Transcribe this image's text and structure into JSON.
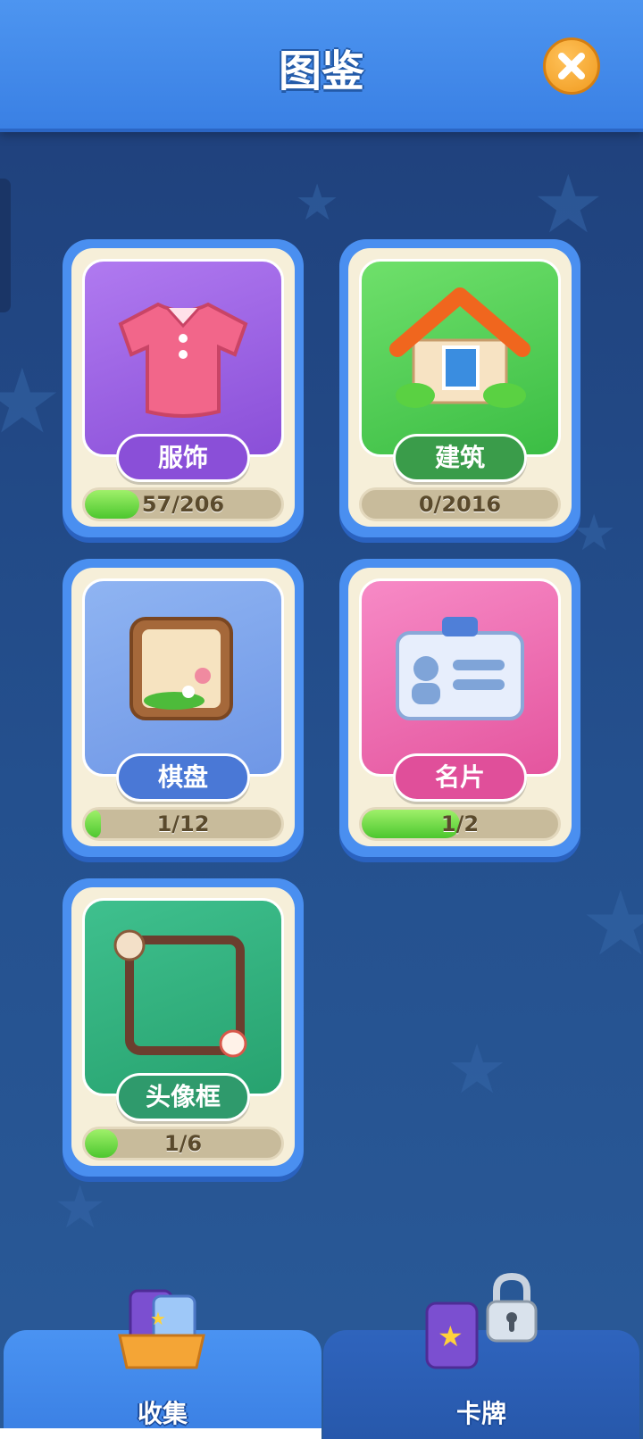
{
  "header": {
    "title": "图鉴"
  },
  "categories": [
    {
      "label": "服饰",
      "progress": "57/206",
      "fill": 0.277,
      "color": "#8a4fd8"
    },
    {
      "label": "建筑",
      "progress": "0/2016",
      "fill": 0.0,
      "color": "#3a9c4a"
    },
    {
      "label": "棋盘",
      "progress": "1/12",
      "fill": 0.083,
      "color": "#4a78d6"
    },
    {
      "label": "名片",
      "progress": "1/2",
      "fill": 0.5,
      "color": "#e04f9a"
    },
    {
      "label": "头像框",
      "progress": "1/6",
      "fill": 0.167,
      "color": "#2f9a6c"
    }
  ],
  "tabs": [
    {
      "label": "收集",
      "locked": false
    },
    {
      "label": "卡牌",
      "locked": true
    }
  ]
}
